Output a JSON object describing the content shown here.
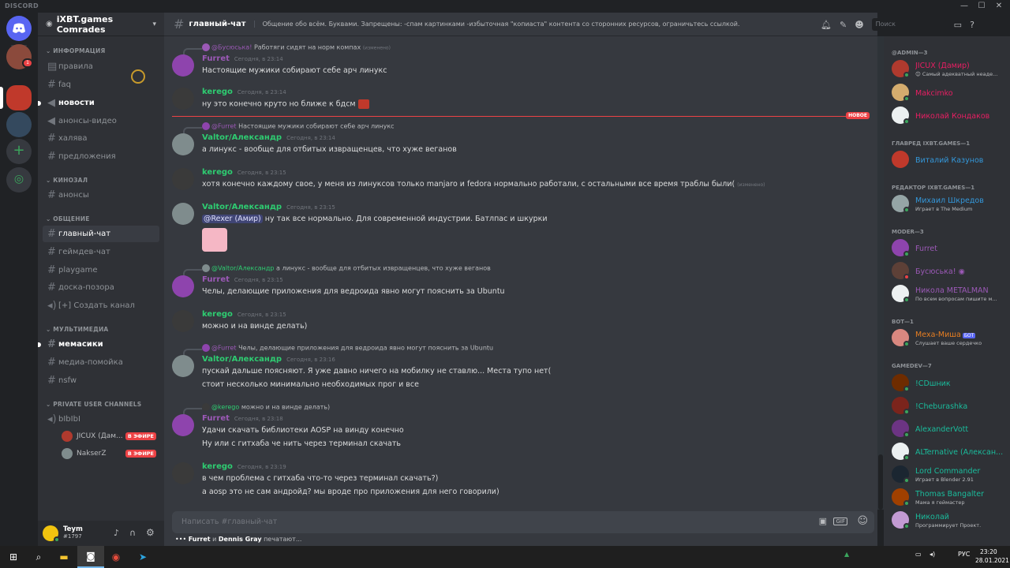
{
  "window": {
    "brand": "DISCORD",
    "min": "—",
    "max": "☐",
    "close": "✕"
  },
  "server": {
    "name": "iXBT.games Comrades"
  },
  "categories": [
    {
      "label": "ИНФОРМАЦИЯ"
    },
    {
      "label": "КИНОЗАЛ"
    },
    {
      "label": "ОБЩЕНИЕ"
    },
    {
      "label": "МУЛЬТИМЕДИА"
    },
    {
      "label": "PRIVATE USER CHANNELS"
    }
  ],
  "channels": {
    "info": [
      "правила",
      "faq",
      "новости",
      "анонсы-видео",
      "халява",
      "предложения"
    ],
    "kino": [
      "анонсы"
    ],
    "talk": [
      "главный-чат",
      "геймдев-чат",
      "playgame",
      "доска-позора",
      "[+] Создать канал"
    ],
    "media": [
      "мемасики",
      "медиа-помойка",
      "nsfw"
    ],
    "private": [
      "bIbIbI"
    ]
  },
  "voice_users": [
    {
      "name": "JICUX (Дам...",
      "badge": "В ЭФИРЕ"
    },
    {
      "name": "NakserZ",
      "badge": "В ЭФИРЕ"
    }
  ],
  "user": {
    "name": "Teym",
    "tag": "#1797"
  },
  "channel": {
    "name": "главный-чат",
    "topic": "Общение обо всём. Буквами. Запрещены: -спам картинками -избыточная \"копиаста\" контента со сторонних ресурсов, ограничьтесь ссылкой."
  },
  "search": {
    "placeholder": "Поиск"
  },
  "messages": [
    {
      "reply_author": "@Бусюська!",
      "reply_text": "Работяги сидят на норм компах",
      "reply_edited": "(изменено)",
      "author": "Furret",
      "ts": "Сегодня, в 23:14",
      "lines": [
        "Настоящие мужики собирают себе арч линукс"
      ]
    },
    {
      "author": "kerego",
      "ts": "Сегодня, в 23:14",
      "lines": [
        "ну это конечно круто но ближе к бдсм"
      ]
    },
    {
      "reply_author": "@Furret",
      "reply_text": "Настоящие мужики собирают себе арч линукс",
      "author": "Valtor/Александр",
      "ts": "Сегодня, в 23:14",
      "lines": [
        "а линукс - вообще для отбитых извращенцев, что хуже веганов"
      ]
    },
    {
      "author": "kerego",
      "ts": "Сегодня, в 23:15",
      "lines": [
        "хотя конечно каждому свое, у меня из линуксов только manjaro и fedora нормально работали, с остальными все время траблы были("
      ],
      "edited": "(изменено)"
    },
    {
      "author": "Valtor/Александр",
      "ts": "Сегодня, в 23:15",
      "mention": "@Rexer (Амир)",
      "lines": [
        "ну так все нормально. Для современной индустрии. Батлпас и шкурки"
      ]
    },
    {
      "reply_author": "@Valtor/Александр",
      "reply_text": "а линукс - вообще для отбитых извращенцев, что хуже веганов",
      "author": "Furret",
      "ts": "Сегодня, в 23:15",
      "lines": [
        "Челы, делающие приложения для ведроида явно могут пояснить за Ubuntu"
      ]
    },
    {
      "author": "kerego",
      "ts": "Сегодня, в 23:15",
      "lines": [
        "можно и на винде делать)"
      ]
    },
    {
      "reply_author": "@Furret",
      "reply_text": "Челы, делающие приложения для ведроида явно могут пояснить за Ubuntu",
      "author": "Valtor/Александр",
      "ts": "Сегодня, в 23:16",
      "lines": [
        "пускай дальше поясняют. Я уже давно ничего на мобилку не ставлю... Места тупо нет(",
        "стоит несколько минимально необходимых прог и все"
      ]
    },
    {
      "reply_author": "@kerego",
      "reply_text": "можно и на винде делать)",
      "author": "Furret",
      "ts": "Сегодня, в 23:18",
      "lines": [
        "Удачи скачать библиотеки AOSP на винду конечно",
        "Ну или с гитхаба че нить через терминал скачать"
      ]
    },
    {
      "author": "kerego",
      "ts": "Сегодня, в 23:19",
      "lines": [
        "в чем проблема с гитхаба что-то через терминал скачать?)",
        "а aosp это не сам андройд? мы вроде про приложения для него говорили)"
      ]
    }
  ],
  "new_label": "НОВОЕ",
  "input": {
    "placeholder": "Написать #главный-чат",
    "gif": "GIF"
  },
  "typing": {
    "user1": "Furret",
    "and": "и",
    "user2": "Dennis Gray",
    "text": "печатают..."
  },
  "members": {
    "groups": [
      {
        "label": "@ADMIN—3",
        "items": [
          {
            "name": "JICUX (Дамир)",
            "sub": "😊 Самый адекватный неаде...",
            "color": "#e91e63"
          },
          {
            "name": "Makcimko",
            "sub": "",
            "color": "#e91e63"
          },
          {
            "name": "Николай Кондаков",
            "sub": "",
            "color": "#e91e63"
          }
        ]
      },
      {
        "label": "ГЛАВРЕД IXBT.GAMES—1",
        "items": [
          {
            "name": "Виталий Казунов",
            "sub": "",
            "color": "#3498db"
          }
        ]
      },
      {
        "label": "РЕДАКТОР IXBT.GAMES—1",
        "items": [
          {
            "name": "Михаил Шкредов",
            "sub": "Играет в The Medium",
            "color": "#3498db"
          }
        ]
      },
      {
        "label": "MODER—3",
        "items": [
          {
            "name": "Furret",
            "sub": "",
            "color": "#9b59b6"
          },
          {
            "name": "Бусюська! ◉",
            "sub": "",
            "color": "#9b59b6"
          },
          {
            "name": "Никола METALMAN",
            "sub": "По всем вопросам пишите м...",
            "color": "#9b59b6"
          }
        ]
      },
      {
        "label": "BOT—1",
        "items": [
          {
            "name": "Меха-Миша",
            "sub": "Слушает ваше сердечко",
            "color": "#e67e22",
            "bot": "БОТ"
          }
        ]
      },
      {
        "label": "GAMEDEV—7",
        "items": [
          {
            "name": "!CDшник",
            "sub": "",
            "color": "#1abc9c"
          },
          {
            "name": "!Cheburashka",
            "sub": "",
            "color": "#1abc9c"
          },
          {
            "name": "AlexanderVott",
            "sub": "",
            "color": "#1abc9c"
          },
          {
            "name": "ALTernative (Алексан...",
            "sub": "",
            "color": "#1abc9c"
          },
          {
            "name": "Lord Commander",
            "sub": "Играет в Blender 2.91",
            "color": "#1abc9c"
          },
          {
            "name": "Thomas Bangalter",
            "sub": "Мама я геймастер",
            "color": "#1abc9c"
          },
          {
            "name": "Николай",
            "sub": "Программирует Проект.",
            "color": "#1abc9c"
          }
        ]
      }
    ]
  },
  "taskbar": {
    "lang": "РУС",
    "time": "23:20",
    "date": "28.01.2021"
  },
  "colors": {
    "furret": "#9b59b6",
    "kerego": "#2ecc71",
    "valtor": "#2ecc71",
    "accent": "#5865f2",
    "red": "#ed4245"
  }
}
